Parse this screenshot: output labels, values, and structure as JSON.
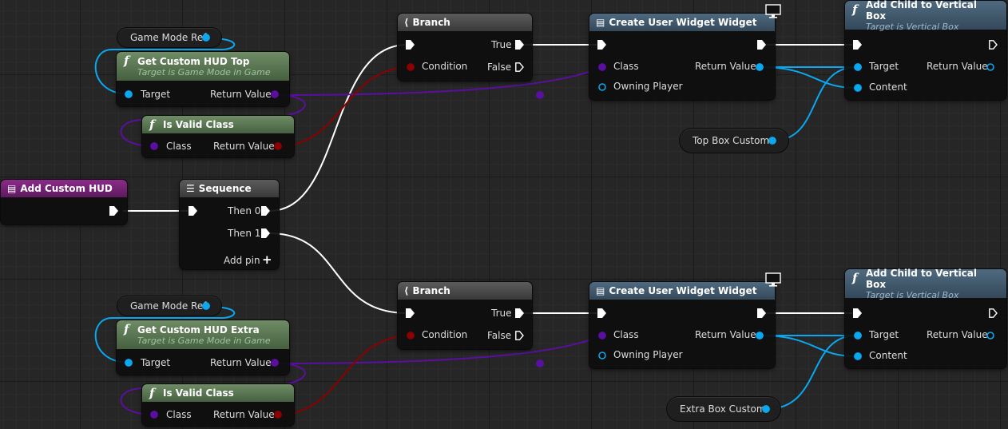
{
  "colors": {
    "exec": "#ffffff",
    "object": "#0aa8f0",
    "class": "#5b0fa0",
    "bool": "#8b0000",
    "grid": "#262626"
  },
  "top": {
    "gm_ref": "Game Mode Ref",
    "get_hud": {
      "title": "Get Custom HUD Top",
      "sub": "Target is Game Mode in Game",
      "target": "Target",
      "ret": "Return Value"
    },
    "valid": {
      "title": "Is Valid Class",
      "cls": "Class",
      "ret": "Return Value"
    },
    "branch": {
      "title": "Branch",
      "true": "True",
      "cond": "Condition",
      "false": "False"
    },
    "create": {
      "title": "Create User Widget Widget",
      "cls": "Class",
      "ret": "Return Value",
      "owner": "Owning Player"
    },
    "add": {
      "title": "Add Child to Vertical Box",
      "sub": "Target is Vertical Box",
      "target": "Target",
      "ret": "Return Value",
      "content": "Content"
    },
    "box_var": "Top Box Custom"
  },
  "bottom": {
    "gm_ref": "Game Mode Ref",
    "get_hud": {
      "title": "Get Custom HUD Extra",
      "sub": "Target is Game Mode in Game",
      "target": "Target",
      "ret": "Return Value"
    },
    "valid": {
      "title": "Is Valid Class",
      "cls": "Class",
      "ret": "Return Value"
    },
    "branch": {
      "title": "Branch",
      "true": "True",
      "cond": "Condition",
      "false": "False"
    },
    "create": {
      "title": "Create User Widget Widget",
      "cls": "Class",
      "ret": "Return Value",
      "owner": "Owning Player"
    },
    "add": {
      "title": "Add Child to Vertical Box",
      "sub": "Target is Vertical Box",
      "target": "Target",
      "ret": "Return Value",
      "content": "Content"
    },
    "box_var": "Extra Box Custom"
  },
  "event": {
    "title": "Add Custom HUD"
  },
  "sequence": {
    "title": "Sequence",
    "then0": "Then 0",
    "then1": "Then 1",
    "add_pin": "Add pin"
  },
  "icons": [
    "function-icon",
    "branch-icon",
    "sequence-icon",
    "widget-icon",
    "event-icon",
    "monitor-icon",
    "exec-pin-icon",
    "add-icon"
  ]
}
